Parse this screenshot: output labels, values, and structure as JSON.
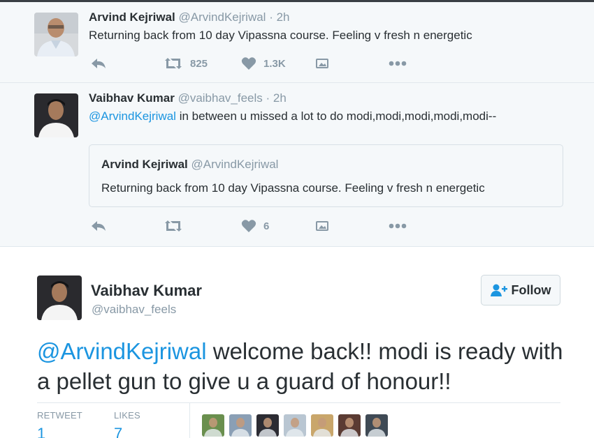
{
  "tweets": [
    {
      "author": {
        "name": "Arvind Kejriwal",
        "handle": "@ArvindKejriwal",
        "avatar_icon": "man-with-glasses-avatar"
      },
      "sep": " · ",
      "time": "2h",
      "text": "Returning back from 10 day Vipassna course. Feeling v fresh n energetic",
      "actions": {
        "retweets": "825",
        "likes": "1.3K"
      }
    },
    {
      "author": {
        "name": "Vaibhav Kumar",
        "handle": "@vaibhav_feels",
        "avatar_icon": "young-man-avatar"
      },
      "sep": " · ",
      "time": "2h",
      "mention": "@ArvindKejriwal",
      "text": " in between u missed a lot to do modi,modi,modi,modi,modi--",
      "quoted": {
        "name": "Arvind Kejriwal",
        "handle": "@ArvindKejriwal",
        "text": "Returning back from 10 day Vipassna course. Feeling v fresh n energetic"
      },
      "actions": {
        "retweets": "",
        "likes": "6"
      }
    }
  ],
  "main": {
    "author": {
      "name": "Vaibhav Kumar",
      "handle": "@vaibhav_feels"
    },
    "follow_label": "Follow",
    "mention": "@ArvindKejriwal",
    "text": " welcome back!! modi is ready with a pellet gun to give u a guard of honour!!",
    "stats": {
      "retweet_label": "RETWEET",
      "retweet_count": "1",
      "likes_label": "LIKES",
      "likes_count": "7"
    },
    "likers": [
      {
        "icon": "liker-avatar-1",
        "color": "#6a8f4e"
      },
      {
        "icon": "liker-avatar-2",
        "color": "#8a9fb5"
      },
      {
        "icon": "liker-avatar-3",
        "color": "#2c2c33"
      },
      {
        "icon": "liker-avatar-4",
        "color": "#b9c6d2"
      },
      {
        "icon": "liker-avatar-5",
        "color": "#c9a66b"
      },
      {
        "icon": "liker-avatar-6",
        "color": "#5b3b33"
      },
      {
        "icon": "liker-avatar-7",
        "color": "#3f4a55"
      }
    ]
  },
  "colors": {
    "accent": "#1b95e0",
    "muted": "#8899a6",
    "text": "#292f33",
    "bg_alt": "#f5f8fa"
  }
}
